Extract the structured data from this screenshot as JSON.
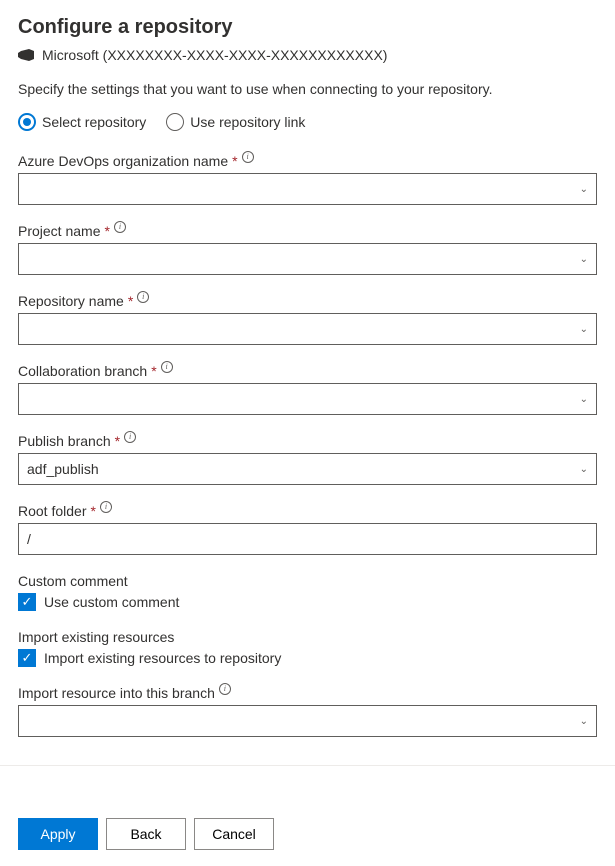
{
  "header": {
    "title": "Configure a repository",
    "org": "Microsoft (XXXXXXXX-XXXX-XXXX-XXXXXXXXXXXX)"
  },
  "description": "Specify the settings that you want to use when connecting to your repository.",
  "repo_mode": {
    "select": "Select repository",
    "link": "Use repository link"
  },
  "fields": {
    "org_name": {
      "label": "Azure DevOps organization name",
      "value": ""
    },
    "project": {
      "label": "Project name",
      "value": ""
    },
    "repo": {
      "label": "Repository name",
      "value": ""
    },
    "collab_branch": {
      "label": "Collaboration branch",
      "value": ""
    },
    "publish_branch": {
      "label": "Publish branch",
      "value": "adf_publish"
    },
    "root_folder": {
      "label": "Root folder",
      "value": "/"
    }
  },
  "custom_comment": {
    "header": "Custom comment",
    "checkbox_label": "Use custom comment"
  },
  "import_resources": {
    "header": "Import existing resources",
    "checkbox_label": "Import existing resources to repository",
    "branch_label": "Import resource into this branch",
    "branch_value": ""
  },
  "buttons": {
    "apply": "Apply",
    "back": "Back",
    "cancel": "Cancel"
  }
}
